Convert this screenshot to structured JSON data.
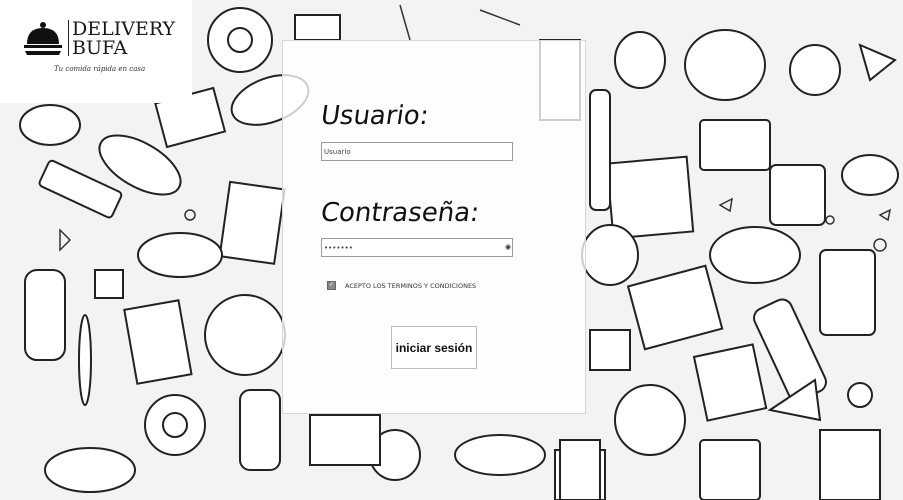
{
  "logo": {
    "line1": "DELIVERY",
    "line2": "BUFA",
    "tagline": "Tu comida rápida en casa",
    "icon": "cloche-serving-icon"
  },
  "login": {
    "user_label": "Usuario:",
    "user_value": "Usuario",
    "password_label": "Contraseña:",
    "password_value": "•••••••",
    "eye_icon": "eye-icon",
    "terms_text": "ACEPTO LOS TERMINOS Y CONDICIONES",
    "terms_checked": true,
    "submit_label": "iniciar sesión"
  },
  "background": {
    "theme": "food-doodle-pattern"
  }
}
